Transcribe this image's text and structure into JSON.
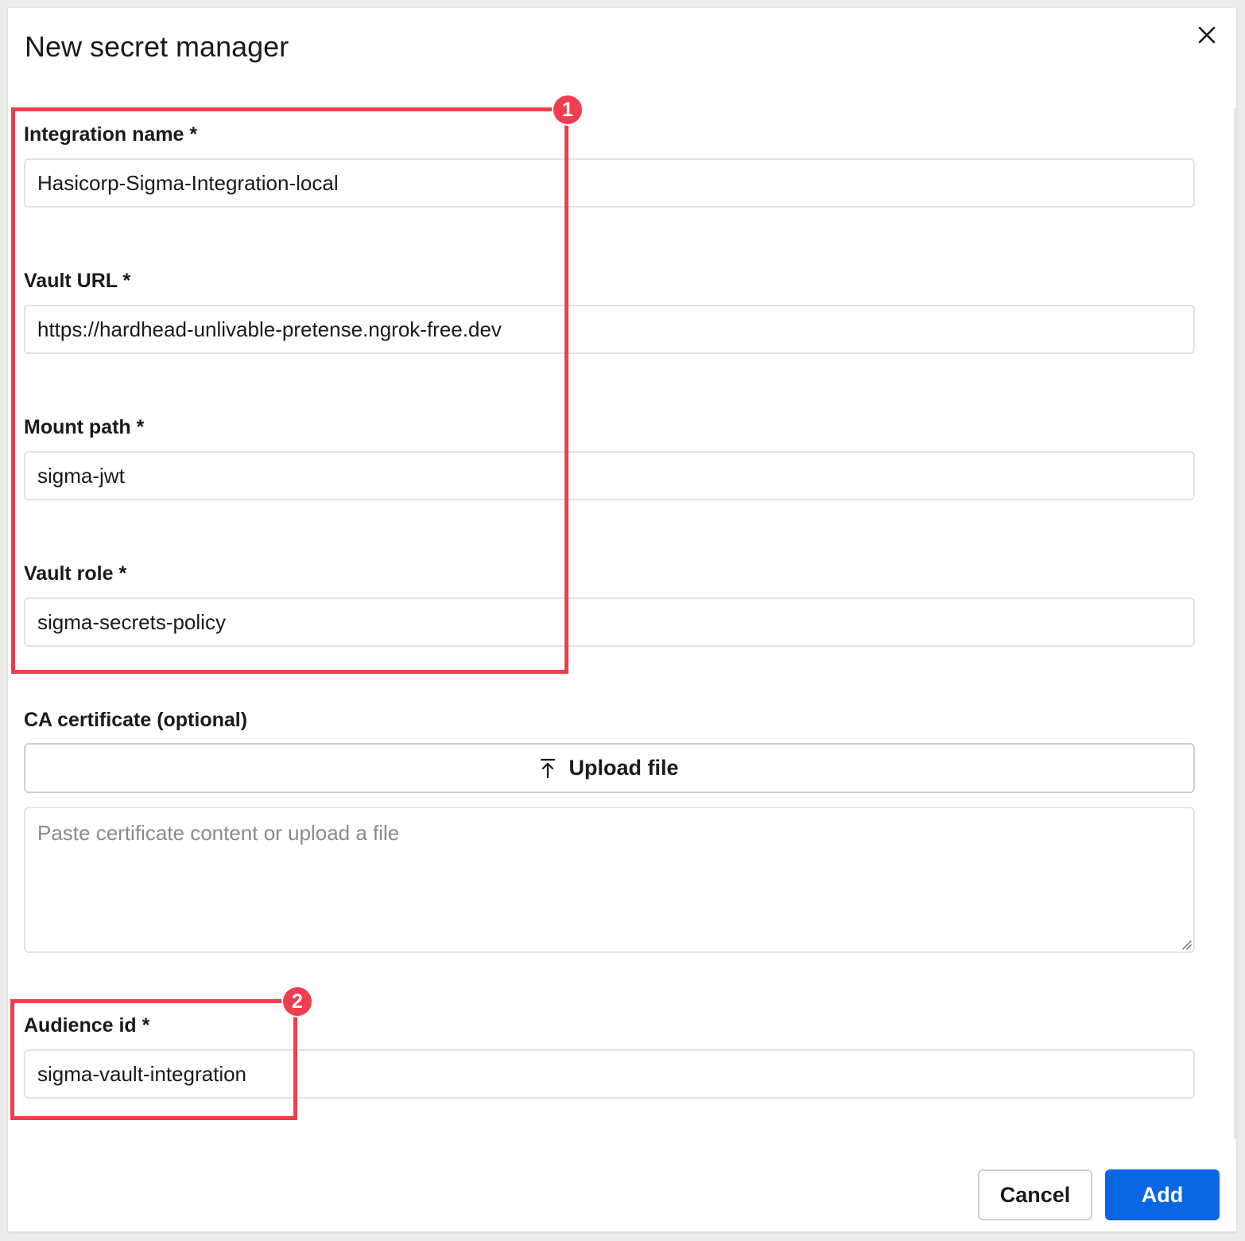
{
  "dialog": {
    "title": "New secret manager",
    "close_icon": "close-icon"
  },
  "fields": {
    "integration_name": {
      "label": "Integration name *",
      "value": "Hasicorp-Sigma-Integration-local"
    },
    "vault_url": {
      "label": "Vault URL *",
      "value": "https://hardhead-unlivable-pretense.ngrok-free.dev"
    },
    "mount_path": {
      "label": "Mount path *",
      "value": "sigma-jwt"
    },
    "vault_role": {
      "label": "Vault role *",
      "value": "sigma-secrets-policy"
    },
    "ca_certificate": {
      "label": "CA certificate (optional)",
      "upload_label": "Upload file",
      "upload_icon": "upload-icon",
      "placeholder": "Paste certificate content or upload a file"
    },
    "audience_id": {
      "label": "Audience id *",
      "value": "sigma-vault-integration"
    }
  },
  "footer": {
    "cancel_label": "Cancel",
    "add_label": "Add"
  },
  "annotations": {
    "badge_1": "1",
    "badge_2": "2"
  },
  "colors": {
    "accent": "#0b66e4",
    "annotation": "#ef3e4e",
    "border": "#e3e3e3"
  }
}
